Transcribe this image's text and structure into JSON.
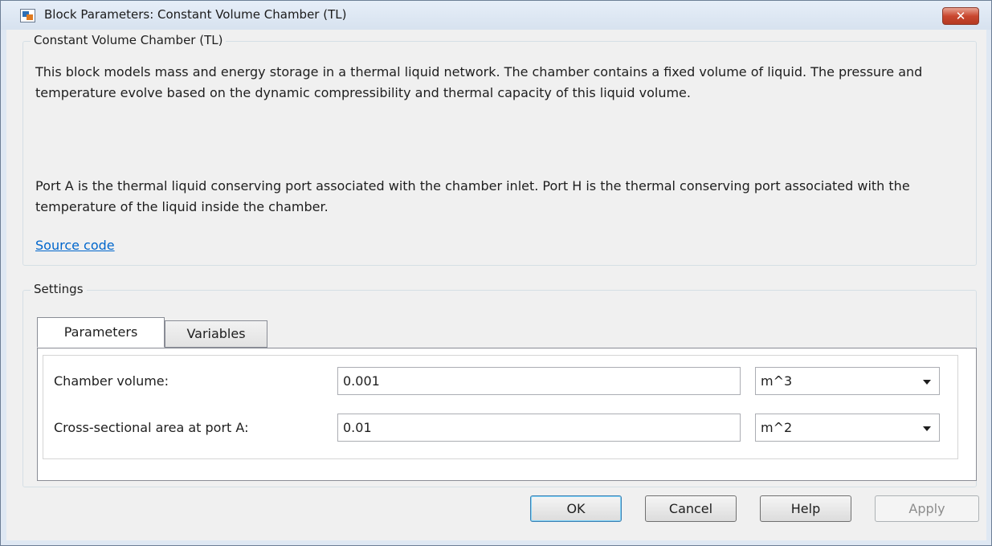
{
  "window": {
    "title": "Block Parameters: Constant Volume Chamber (TL)",
    "close_symbol": "✕"
  },
  "block": {
    "group_label": "Constant Volume Chamber (TL)",
    "description_1": "This block models mass and energy storage in a thermal liquid network. The chamber contains a fixed volume of liquid. The pressure and temperature evolve based on the dynamic compressibility and thermal capacity of this liquid volume.",
    "description_2": "Port A is the thermal liquid conserving port associated with the chamber inlet. Port H is the thermal conserving port associated with the temperature of the liquid inside the chamber.",
    "source_link": "Source code"
  },
  "settings": {
    "group_label": "Settings",
    "tabs": [
      {
        "label": "Parameters",
        "active": true
      },
      {
        "label": "Variables",
        "active": false
      }
    ],
    "params": [
      {
        "label": "Chamber volume:",
        "value": "0.001",
        "unit": "m^3"
      },
      {
        "label": "Cross-sectional area at port A:",
        "value": "0.01",
        "unit": "m^2"
      }
    ]
  },
  "buttons": {
    "ok": "OK",
    "cancel": "Cancel",
    "help": "Help",
    "apply": "Apply"
  },
  "colors": {
    "link": "#0066cc",
    "close_button": "#c9472f",
    "window_frame": "#dfe8f3"
  },
  "icons": [
    "simulink-block-icon",
    "close-icon",
    "chevron-down-icon"
  ]
}
